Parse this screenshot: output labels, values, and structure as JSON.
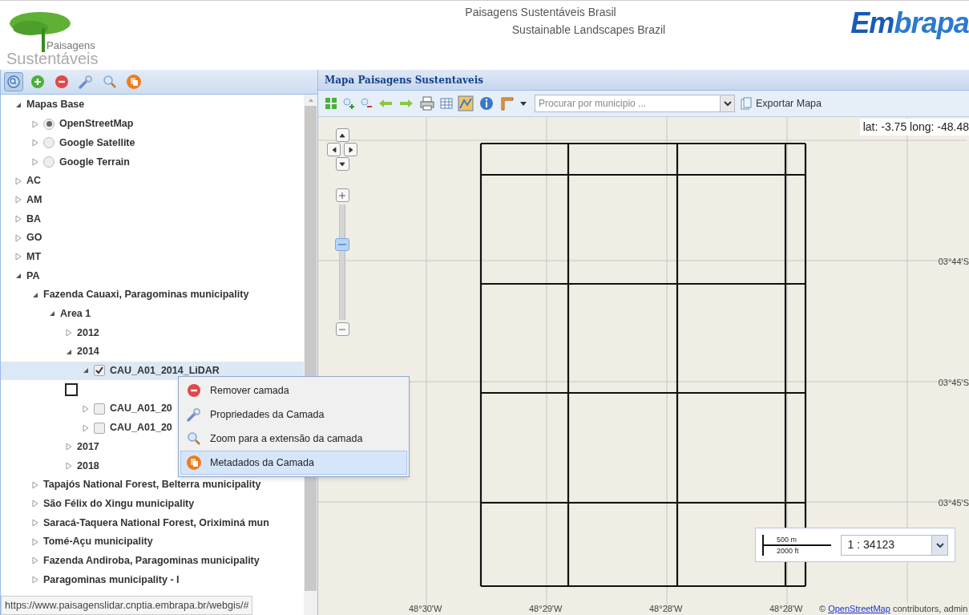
{
  "header": {
    "logo_line1": "Paisagens",
    "logo_line2": "Sustentáveis",
    "title_pt": "Paisagens Sustentáveis Brasil",
    "title_en": "Sustainable Landscapes Brazil",
    "brand_a": "Em",
    "brand_b": "brapa"
  },
  "left_toolbar": [
    {
      "kind": "identify",
      "selected": true
    },
    {
      "kind": "add",
      "selected": false
    },
    {
      "kind": "remove",
      "selected": false
    },
    {
      "kind": "properties",
      "selected": false
    },
    {
      "kind": "zoom",
      "selected": false
    },
    {
      "kind": "metadata",
      "selected": false
    }
  ],
  "tree": [
    {
      "label": "Mapas Base",
      "kind": "folder",
      "expanded": true,
      "selected": false,
      "children": [
        {
          "label": "OpenStreetMap",
          "kind": "radio",
          "checked": true,
          "expanded": false,
          "selected": false
        },
        {
          "label": "Google Satellite",
          "kind": "radio",
          "checked": false,
          "expanded": false,
          "selected": false
        },
        {
          "label": "Google Terrain",
          "kind": "radio",
          "checked": false,
          "expanded": false,
          "selected": false
        }
      ]
    },
    {
      "label": "AC",
      "kind": "folder",
      "expanded": false,
      "selected": false
    },
    {
      "label": "AM",
      "kind": "folder",
      "expanded": false,
      "selected": false
    },
    {
      "label": "BA",
      "kind": "folder",
      "expanded": false,
      "selected": false
    },
    {
      "label": "GO",
      "kind": "folder",
      "expanded": false,
      "selected": false
    },
    {
      "label": "MT",
      "kind": "folder",
      "expanded": false,
      "selected": false
    },
    {
      "label": "PA",
      "kind": "folder",
      "expanded": true,
      "selected": false,
      "children": [
        {
          "label": "Fazenda Cauaxi, Paragominas municipality",
          "kind": "folder",
          "expanded": true,
          "selected": false,
          "children": [
            {
              "label": "Area 1",
              "kind": "folder",
              "expanded": true,
              "selected": false,
              "children": [
                {
                  "label": "2012",
                  "kind": "folder",
                  "expanded": false,
                  "selected": false
                },
                {
                  "label": "2014",
                  "kind": "folder",
                  "expanded": true,
                  "selected": false,
                  "children": [
                    {
                      "label": "CAU_A01_2014_LiDAR",
                      "kind": "checkbox",
                      "checked": true,
                      "expanded": true,
                      "selected": true
                    },
                    {
                      "kind": "box",
                      "checked": false
                    },
                    {
                      "label": "CAU_A01_20",
                      "kind": "checkbox",
                      "checked": false,
                      "expanded": false,
                      "selected": false
                    },
                    {
                      "label": "CAU_A01_20",
                      "kind": "checkbox",
                      "checked": false,
                      "expanded": false,
                      "selected": false
                    }
                  ]
                },
                {
                  "label": "2017",
                  "kind": "folder",
                  "expanded": false,
                  "selected": false
                },
                {
                  "label": "2018",
                  "kind": "folder",
                  "expanded": false,
                  "selected": false
                }
              ]
            }
          ]
        },
        {
          "label": "Tapajós National Forest, Belterra municipality",
          "kind": "folder",
          "expanded": false,
          "selected": false
        },
        {
          "label": "São Félix do Xingu municipality",
          "kind": "folder",
          "expanded": false,
          "selected": false
        },
        {
          "label": "Saracá-Taquera National Forest, Oriximiná mun",
          "kind": "folder",
          "expanded": false,
          "selected": false
        },
        {
          "label": "Tomé-Açu municipality",
          "kind": "folder",
          "expanded": false,
          "selected": false
        },
        {
          "label": "Fazenda Andiroba, Paragominas municipality",
          "kind": "folder",
          "expanded": false,
          "selected": false
        },
        {
          "label": "Paragominas municipality - I",
          "kind": "folder",
          "expanded": false,
          "selected": false
        }
      ]
    }
  ],
  "context_menu": [
    {
      "kind": "remove",
      "label": "Remover camada",
      "selected": false
    },
    {
      "kind": "properties",
      "label": "Propriedades da Camada",
      "selected": false
    },
    {
      "kind": "zoom",
      "label": "Zoom para a extensão da camada",
      "selected": false
    },
    {
      "kind": "metadata",
      "label": "Metadados da Camada",
      "selected": true
    }
  ],
  "status_url": "https://www.paisagenslidar.cnptia.embrapa.br/webgis/#",
  "map_panel": {
    "title": "Mapa Paisagens Sustentaveis",
    "search_placeholder": "Procurar por municipio ...",
    "export_label": "Exportar Mapa",
    "coords": "lat: -3.75 long: -48.48",
    "lat_labels": [
      "03°44'S",
      "03°45'S",
      "03°45'S"
    ],
    "lon_labels": [
      "48°30'W",
      "48°29'W",
      "48°28'W",
      "48°28'W"
    ],
    "attribution_prefix": "©",
    "attribution_link": "OpenStreetMap",
    "attribution_rest": "contributors, admin",
    "scale_m": "500 m",
    "scale_ft": "2000 ft",
    "scale_ratio": "1 : 34123"
  }
}
